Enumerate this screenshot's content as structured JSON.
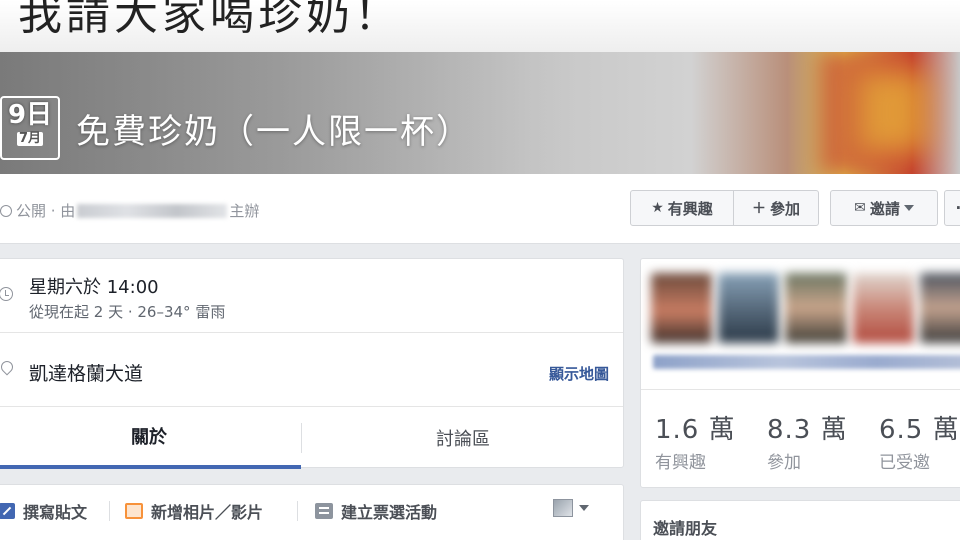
{
  "headline": {
    "text": "我請大家喝珍奶！"
  },
  "event": {
    "date_day": "9日",
    "date_month": "7月",
    "title": "免費珍奶（一人限一杯）",
    "privacy": "公開 · 由",
    "host_suffix": "主辦"
  },
  "actions": {
    "interested": "有興趣",
    "join": "參加",
    "invite": "邀請",
    "more": "···"
  },
  "details": {
    "time_main": "星期六於 14:00",
    "time_sub": "從現在起 2 天 · 26–34° 雷雨",
    "place": "凱達格蘭大道",
    "map_link": "顯示地圖"
  },
  "tabs": [
    {
      "label": "關於",
      "active": true
    },
    {
      "label": "討論區",
      "active": false
    }
  ],
  "composer": {
    "write": "撰寫貼文",
    "photo": "新增相片／影片",
    "poll": "建立票選活動"
  },
  "stats": [
    {
      "value": "1.6 萬",
      "label": "有興趣"
    },
    {
      "value": "8.3 萬",
      "label": "參加"
    },
    {
      "value": "6.5 萬",
      "label": "已受邀"
    }
  ],
  "invite_friends": {
    "title": "邀請朋友"
  },
  "colors": {
    "accent": "#4267b2",
    "link": "#365899",
    "background": "#e9ebee"
  }
}
